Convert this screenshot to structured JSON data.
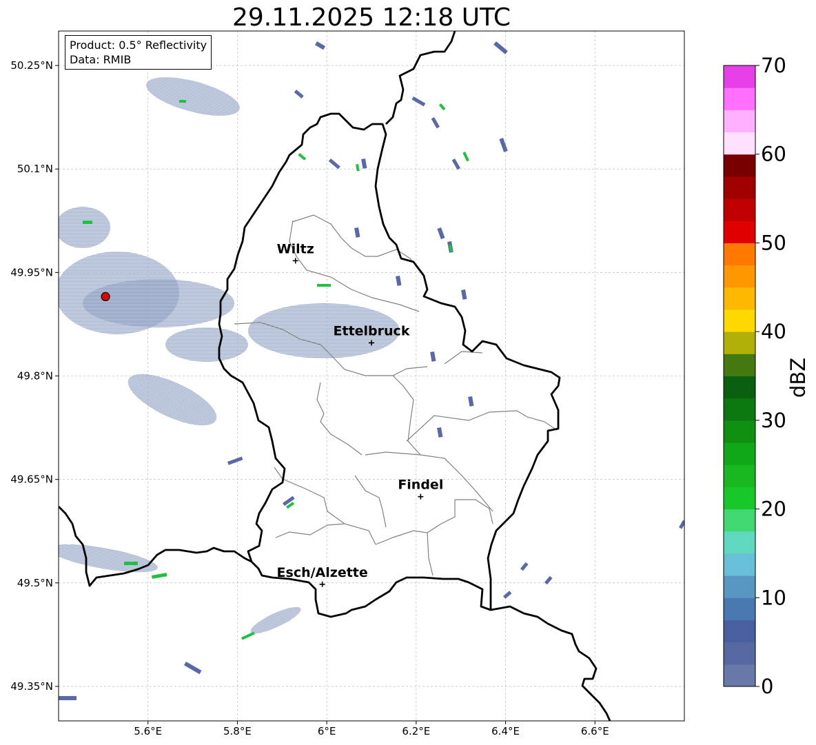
{
  "title": "29.11.2025 12:18 UTC",
  "info": {
    "product": "Product: 0.5° Reflectivity",
    "data": "Data: RMIB"
  },
  "map": {
    "lon_range": [
      5.4,
      6.8
    ],
    "lat_range": [
      49.3,
      50.3
    ],
    "x_ticks": [
      {
        "value": 5.6,
        "label": "5.6°E"
      },
      {
        "value": 5.8,
        "label": "5.8°E"
      },
      {
        "value": 6.0,
        "label": "6°E"
      },
      {
        "value": 6.2,
        "label": "6.2°E"
      },
      {
        "value": 6.4,
        "label": "6.4°E"
      },
      {
        "value": 6.6,
        "label": "6.6°E"
      }
    ],
    "y_ticks": [
      {
        "value": 50.25,
        "label": "50.25°N"
      },
      {
        "value": 50.1,
        "label": "50.1°N"
      },
      {
        "value": 49.95,
        "label": "49.95°N"
      },
      {
        "value": 49.8,
        "label": "49.8°N"
      },
      {
        "value": 49.65,
        "label": "49.65°N"
      },
      {
        "value": 49.5,
        "label": "49.5°N"
      },
      {
        "value": 49.35,
        "label": "49.35°N"
      }
    ],
    "cities": [
      {
        "name": "Wiltz",
        "lon": 5.93,
        "lat": 49.967
      },
      {
        "name": "Ettelbruck",
        "lon": 6.1,
        "lat": 49.848
      },
      {
        "name": "Findel",
        "lon": 6.21,
        "lat": 49.625
      },
      {
        "name": "Esch/Alzette",
        "lon": 5.99,
        "lat": 49.498
      }
    ],
    "radar_site": {
      "lon": 5.505,
      "lat": 49.915,
      "color": "#e00000"
    }
  },
  "colorbar": {
    "label": "dBZ",
    "min": 0,
    "max": 70,
    "step": 2.5,
    "ticks": [
      {
        "value": 0,
        "label": "0"
      },
      {
        "value": 10,
        "label": "10"
      },
      {
        "value": 20,
        "label": "20"
      },
      {
        "value": 30,
        "label": "30"
      },
      {
        "value": 40,
        "label": "40"
      },
      {
        "value": 50,
        "label": "50"
      },
      {
        "value": 60,
        "label": "60"
      },
      {
        "value": 70,
        "label": "70"
      }
    ],
    "colors": [
      "#6878a8",
      "#5568a0",
      "#4860a0",
      "#4a78b0",
      "#5898c0",
      "#68c0d8",
      "#60d8c0",
      "#40d870",
      "#18c828",
      "#18b820",
      "#10a818",
      "#109010",
      "#0c7810",
      "#0a6010",
      "#447810",
      "#b0b008",
      "#ffd800",
      "#ffb800",
      "#ff9800",
      "#ff7800",
      "#e00000",
      "#c00000",
      "#a00000",
      "#780000",
      "#ffe0ff",
      "#ffb0ff",
      "#ff70ff",
      "#e840e8"
    ]
  }
}
